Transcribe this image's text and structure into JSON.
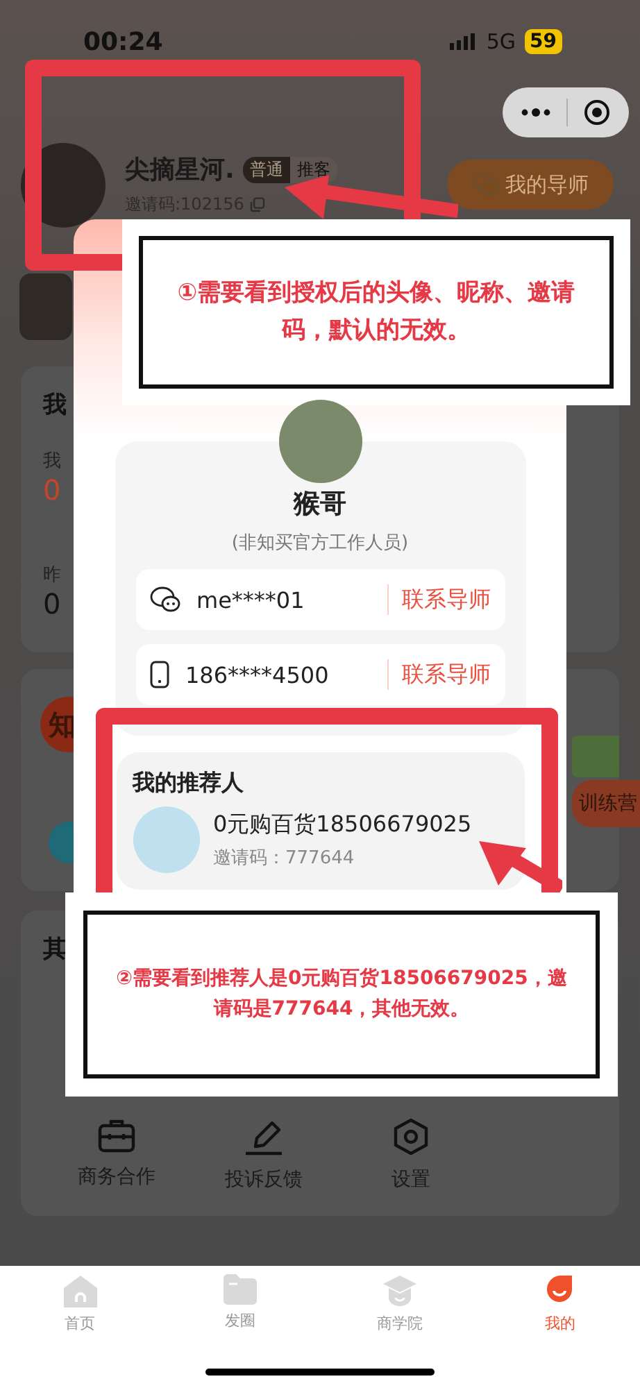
{
  "status_bar": {
    "time": "00:24",
    "network": "5G",
    "battery": "59"
  },
  "profile": {
    "nickname": "尖摘星河.",
    "badges": [
      {
        "label": "普通",
        "kind": "level"
      },
      {
        "label": "推客",
        "kind": "role"
      }
    ],
    "invite_code": "邀请码:102156",
    "mentor_button": "我的导师"
  },
  "stats_card": {
    "title": "我",
    "label": "我",
    "value": "0",
    "yesterday_label": "昨",
    "yesterday_value": "0"
  },
  "promo_card": {
    "icon_text": "知",
    "banner": "训练营"
  },
  "other_card": {
    "title": "其",
    "tools": [
      {
        "kind": "briefcase",
        "label": "商务合作"
      },
      {
        "kind": "pencil",
        "label": "投诉反馈"
      },
      {
        "kind": "settings",
        "label": "设置"
      }
    ]
  },
  "mentor_sheet": {
    "name": "猴哥",
    "note": "(非知买官方工作人员)",
    "contacts": [
      {
        "kind": "wechat",
        "value": "me****01",
        "action": "联系导师"
      },
      {
        "kind": "phone",
        "value": "186****4500",
        "action": "联系导师"
      }
    ]
  },
  "referrer": {
    "title": "我的推荐人",
    "name": "0元购百货18506679025",
    "invite_code": "邀请码：777644"
  },
  "annotations": [
    {
      "text": "①需要看到授权后的头像、昵称、邀请码，默认的无效。"
    },
    {
      "text": "②需要看到推荐人是0元购百货18506679025，邀请码是777644，其他无效。"
    }
  ],
  "tab_bar": [
    {
      "kind": "home",
      "label": "首页",
      "selected": false
    },
    {
      "kind": "folder",
      "label": "发圈",
      "selected": false
    },
    {
      "kind": "school",
      "label": "商学院",
      "selected": false
    },
    {
      "kind": "me",
      "label": "我的",
      "selected": true
    }
  ]
}
